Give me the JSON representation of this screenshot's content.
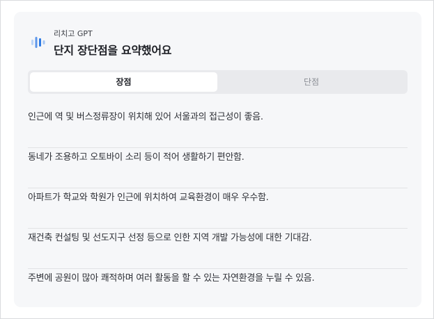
{
  "header": {
    "brand": "리치고 GPT",
    "title": "단지 장단점을 요약했어요",
    "logo_icon": "voice-wave-icon",
    "logo_colors": [
      "#b9d3f7",
      "#5d97ea",
      "#2d7ae3",
      "#a6c6f3"
    ]
  },
  "tabs": [
    {
      "label": "장점",
      "active": true
    },
    {
      "label": "단점",
      "active": false
    }
  ],
  "pros": [
    "인근에 역 및 버스정류장이 위치해 있어 서울과의 접근성이 좋음.",
    "동네가 조용하고 오토바이 소리 등이 적어 생활하기 편안함.",
    "아파트가 학교와 학원가 인근에 위치하여 교육환경이 매우 우수함.",
    "재건축 컨설팅 및 선도지구 선정 등으로 인한 지역 개발 가능성에 대한 기대감.",
    "주변에 공원이 많아 쾌적하며 여러 활동을 할 수 있는 자연환경을 누릴 수 있음."
  ]
}
